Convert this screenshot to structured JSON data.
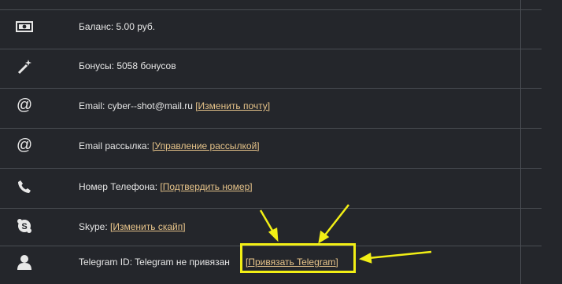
{
  "rows": [
    {
      "icon": "banknote-icon",
      "text": "Баланс: 5.00 руб.",
      "link": ""
    },
    {
      "icon": "magic-wand-icon",
      "text": "Бонусы: 5058 бонусов",
      "link": ""
    },
    {
      "icon": "at-sign-icon",
      "text": "Email: cyber--shot@mail.ru ",
      "link": "[Изменить почту]"
    },
    {
      "icon": "at-sign-icon",
      "text": "Email рассылка: ",
      "link": "[Управление рассылкой]"
    },
    {
      "icon": "phone-icon",
      "text": "Номер Телефона: ",
      "link": "[Подтвердить номер]"
    },
    {
      "icon": "skype-icon",
      "text": "Skype: ",
      "link": "[Изменить скайп]"
    },
    {
      "icon": "user-icon",
      "text": "Telegram ID: Telegram не привязан",
      "link": "[Привязать Telegram]"
    }
  ],
  "colors": {
    "background": "#24262b",
    "link": "#e7c48a",
    "highlight": "#f2ef15"
  }
}
